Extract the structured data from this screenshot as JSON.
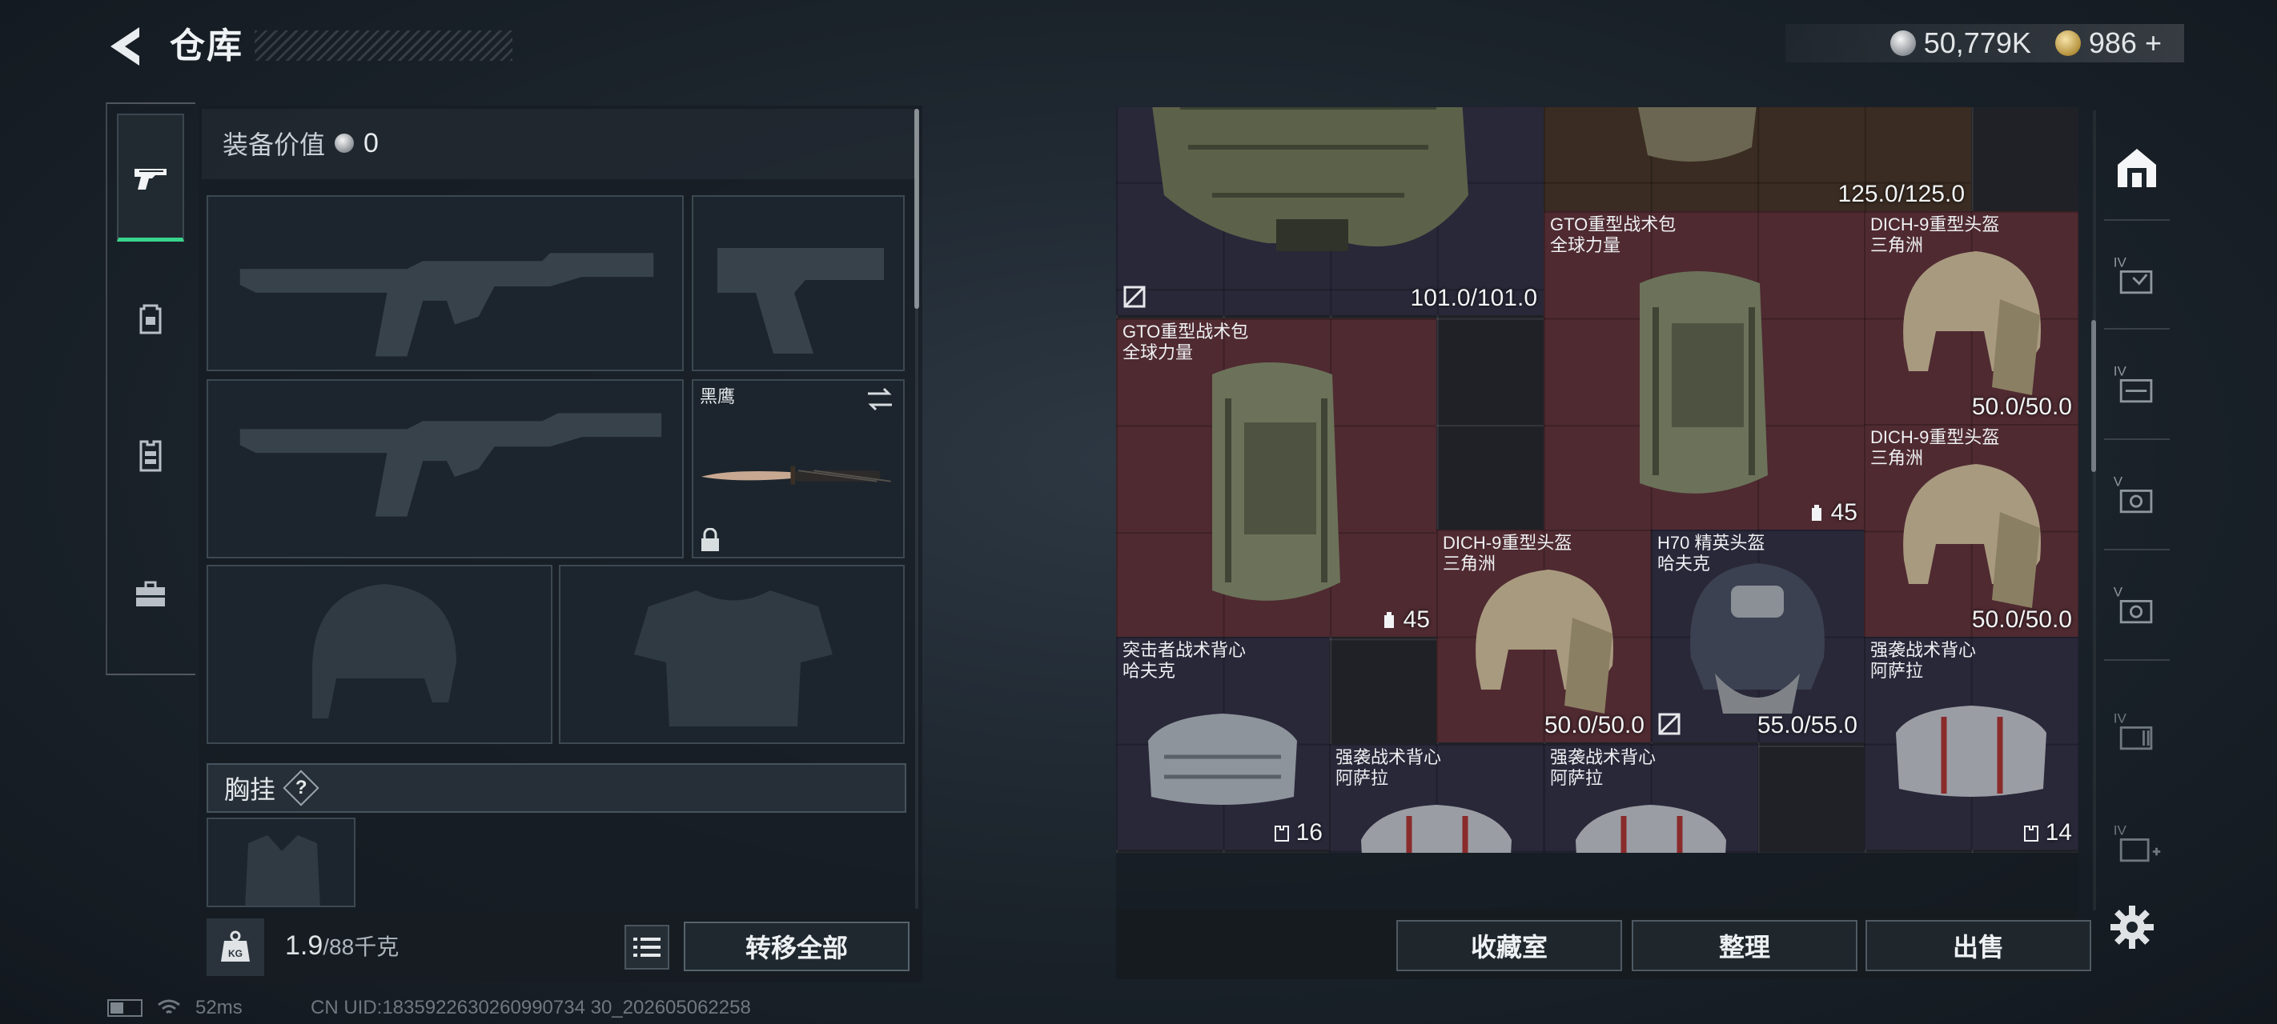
{
  "header": {
    "title": "仓库",
    "silver_amount": "50,779K",
    "gold_amount": "986",
    "gold_plus": "+"
  },
  "left_rail": {
    "tabs": [
      {
        "icon": "pistol-icon",
        "active": true
      },
      {
        "icon": "backpack-icon",
        "active": false
      },
      {
        "icon": "vest-icon",
        "active": false
      },
      {
        "icon": "toolbox-icon",
        "active": false
      }
    ]
  },
  "equipment": {
    "value_label": "装备价值",
    "value": "0",
    "melee_name": "黑鹰",
    "chest_label": "胸挂",
    "chest_help": "?",
    "weight_current": "1.9",
    "weight_max": "/88千克",
    "weight_icon_text": "KG",
    "transfer_all": "转移全部"
  },
  "storage": {
    "items": [
      {
        "name1": "",
        "name2": "",
        "durability": "101.0/101.0"
      },
      {
        "name1": "",
        "name2": "",
        "durability": "125.0/125.0"
      },
      {
        "name1": "GTO重型战术包",
        "name2": "全球力量",
        "capacity": "45"
      },
      {
        "name1": "DICH-9重型头盔",
        "name2": "三角洲",
        "durability": "50.0/50.0"
      },
      {
        "name1": "GTO重型战术包",
        "name2": "全球力量",
        "capacity": "45"
      },
      {
        "name1": "DICH-9重型头盔",
        "name2": "三角洲",
        "durability": "50.0/50.0"
      },
      {
        "name1": "DICH-9重型头盔",
        "name2": "三角洲",
        "durability": "50.0/50.0"
      },
      {
        "name1": "H70 精英头盔",
        "name2": "哈夫克",
        "durability": "55.0/55.0"
      },
      {
        "name1": "突击者战术背心",
        "name2": "哈夫克",
        "capacity": "16"
      },
      {
        "name1": "强袭战术背心",
        "name2": "阿萨拉",
        "capacity": "14"
      },
      {
        "name1": "强袭战术背心",
        "name2": "阿萨拉",
        "capacity": ""
      },
      {
        "name1": "强袭战术背心",
        "name2": "阿萨拉",
        "capacity": ""
      }
    ],
    "btn_collection": "收藏室",
    "btn_sort": "整理",
    "btn_sell": "出售"
  },
  "right_rail": {
    "tabs": [
      "IV",
      "IV",
      "V",
      "V",
      "IV",
      "IV"
    ]
  },
  "status": {
    "ping": "52ms",
    "uid": "CN UID:1835922630260990734 30_202605062258"
  },
  "colors": {
    "accent_green": "#39d58c",
    "rarity_red": "#4f2a31",
    "rarity_purple": "#292839"
  }
}
